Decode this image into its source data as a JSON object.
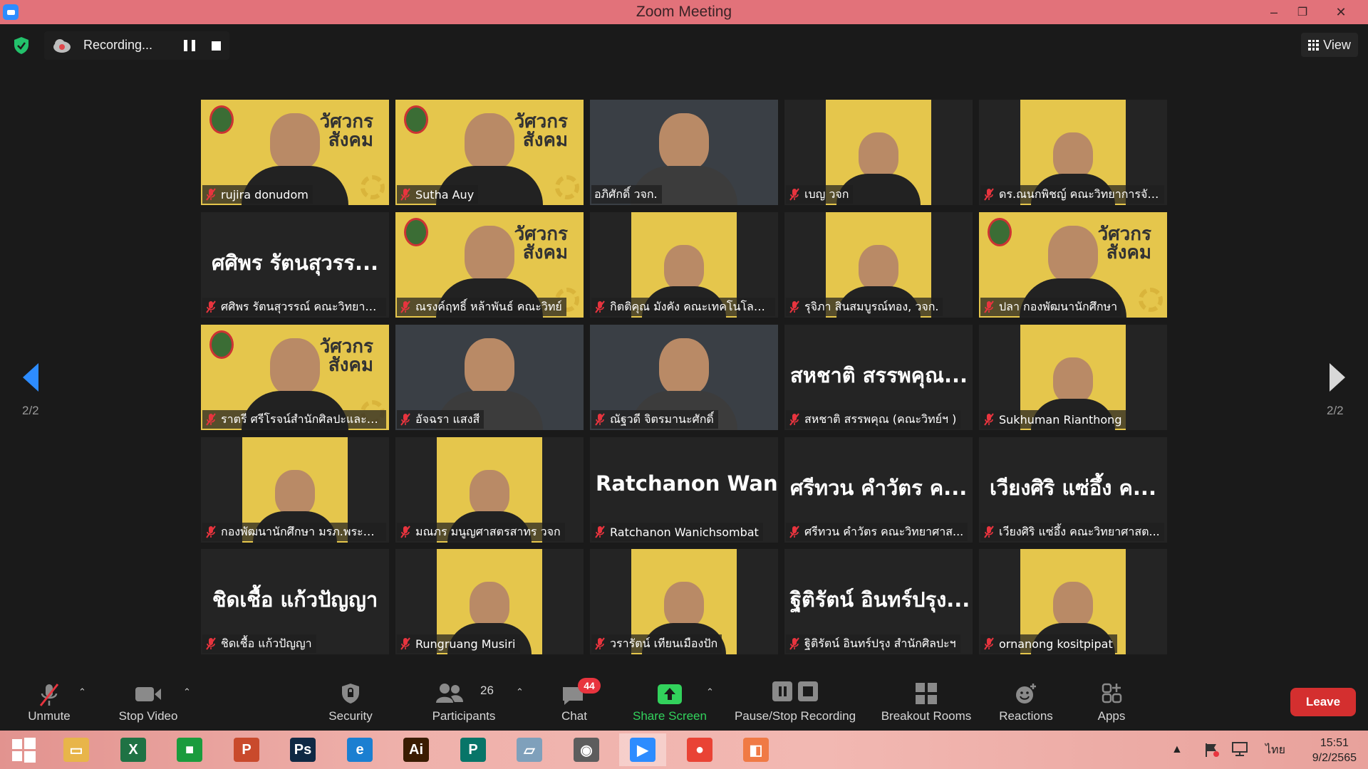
{
  "window": {
    "title": "Zoom Meeting",
    "minimize": "–",
    "restore": "❐",
    "close": "✕"
  },
  "recording": {
    "label": "Recording..."
  },
  "view": {
    "label": "View"
  },
  "gallery": {
    "page_left": "2/2",
    "page_right": "2/2",
    "tiles": [
      {
        "name": "rujira donudom",
        "kind": "video"
      },
      {
        "name": "Sutha Auy",
        "kind": "video"
      },
      {
        "name": "อภิศักดิ์ วจก.",
        "kind": "gray",
        "muted": false
      },
      {
        "name": "เบญ วจก",
        "kind": "narrow"
      },
      {
        "name": "ดร.ณนกพิชญ์ คณะวิทยาการจัด...",
        "kind": "narrow"
      },
      {
        "name": "ศศิพร รัตนสุวรรณ์ คณะวิทยาศ...",
        "kind": "name",
        "big": "ศศิพร รัตนสุวรร..."
      },
      {
        "name": "ณรงค์ฤทธิ์ หล้าพันธ์ คณะวิทย์",
        "kind": "video"
      },
      {
        "name": "กิตติคุณ มังคัง คณะเทคโนโลยีอุ...",
        "kind": "narrow"
      },
      {
        "name": "รุจิภา สินสมบูรณ์ทอง, วจก.",
        "kind": "narrow"
      },
      {
        "name": "ปลา กองพัฒนานักศึกษา",
        "kind": "video"
      },
      {
        "name": "ราตรี   ศรีโรจน์สำนักศิลปะและวั...",
        "kind": "video"
      },
      {
        "name": "อัจฉรา แสงสี",
        "kind": "gray"
      },
      {
        "name": "ณัฐวดี จิตรมานะศักดิ์",
        "kind": "gray"
      },
      {
        "name": "สหชาติ สรรพคุณ (คณะวิทย์ฯ )",
        "kind": "name",
        "big": "สหชาติ สรรพคุณ..."
      },
      {
        "name": "Sukhuman Rianthong",
        "kind": "narrow"
      },
      {
        "name": "กองพัฒนานักศึกษา มรภ.พระนคร",
        "kind": "narrow"
      },
      {
        "name": "มณภร มนูญศาสตรสาทร วจก",
        "kind": "narrow"
      },
      {
        "name": "Ratchanon Wanichsombat",
        "kind": "name",
        "big": "Ratchanon  Wan..."
      },
      {
        "name": "ศรีทวน  คำวัตร คณะวิทยาศาส...",
        "kind": "name",
        "big": "ศรีทวน  คำวัตร ค..."
      },
      {
        "name": "เวียงศิริ  แซ่อึ้ง  คณะวิทยาศาสต...",
        "kind": "name",
        "big": "เวียงศิริ  แซ่อึ้ง  ค..."
      },
      {
        "name": "ชิดเชื้อ แก้วปัญญา",
        "kind": "name",
        "big": "ชิดเชื้อ แก้วปัญญา"
      },
      {
        "name": "Rungruang Musiri",
        "kind": "narrow"
      },
      {
        "name": "วรารัตน์ เทียนเมืองปัก",
        "kind": "narrow"
      },
      {
        "name": "ฐิติรัตน์ อินทร์ปรุง สำนักศิลปะฯ",
        "kind": "name",
        "big": "ฐิติรัตน์ อินทร์ปรุง..."
      },
      {
        "name": "ornanong kositpipat",
        "kind": "narrow"
      }
    ],
    "poster_text": "วัศวกร\nสังคม"
  },
  "toolbar": {
    "unmute": "Unmute",
    "stop_video": "Stop Video",
    "security": "Security",
    "participants": "Participants",
    "participants_count": "26",
    "chat": "Chat",
    "chat_badge": "44",
    "share_screen": "Share Screen",
    "pause_stop_recording": "Pause/Stop Recording",
    "breakout_rooms": "Breakout Rooms",
    "reactions": "Reactions",
    "apps": "Apps",
    "leave": "Leave"
  },
  "taskbar": {
    "apps": [
      {
        "name": "file-explorer",
        "color": "#e8b54a",
        "glyph": "▭"
      },
      {
        "name": "excel",
        "color": "#1f7244",
        "glyph": "X"
      },
      {
        "name": "store",
        "color": "#1a9b3d",
        "glyph": "■"
      },
      {
        "name": "powerpoint",
        "color": "#c94a2c",
        "glyph": "P"
      },
      {
        "name": "photoshop",
        "color": "#0f2944",
        "glyph": "Ps"
      },
      {
        "name": "internet-explorer",
        "color": "#1b7fd1",
        "glyph": "e"
      },
      {
        "name": "illustrator",
        "color": "#3a1c02",
        "glyph": "Ai"
      },
      {
        "name": "publisher",
        "color": "#077568",
        "glyph": "P"
      },
      {
        "name": "notepad",
        "color": "#7fa0bb",
        "glyph": "▱"
      },
      {
        "name": "photoscape",
        "color": "#5d5d5d",
        "glyph": "◉"
      },
      {
        "name": "zoom",
        "color": "#2d8cff",
        "glyph": "▶"
      },
      {
        "name": "chrome",
        "color": "#e94335",
        "glyph": "●"
      },
      {
        "name": "photos",
        "color": "#f07a45",
        "glyph": "◧"
      }
    ],
    "language": "ไทย",
    "time": "15:51",
    "date": "9/2/2565"
  },
  "colors": {
    "titlebar": "#e2727a",
    "share_green": "#32d25c",
    "leave_red": "#d42f2f",
    "muted_red": "#e8343e"
  }
}
